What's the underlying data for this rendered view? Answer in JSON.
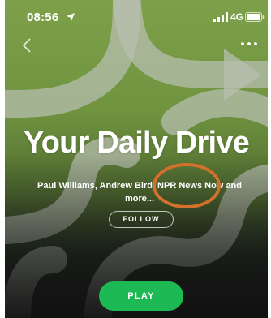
{
  "status_bar": {
    "time": "08:56",
    "network": "4G",
    "location_icon": "location-arrow-icon",
    "signal_icon": "signal-bars-icon",
    "battery_icon": "battery-icon"
  },
  "nav": {
    "back_icon": "chevron-left-icon",
    "more_icon": "more-horizontal-icon"
  },
  "playlist": {
    "title": "Your Daily Drive",
    "subtitle": "Paul Williams, Andrew Bird, NPR News Now and more...",
    "follow_label": "FOLLOW",
    "play_label": "PLAY"
  },
  "colors": {
    "cover_green": "#7ea04a",
    "background_dark": "#121212",
    "play_green": "#1db954",
    "highlight_orange": "#d2702d"
  }
}
